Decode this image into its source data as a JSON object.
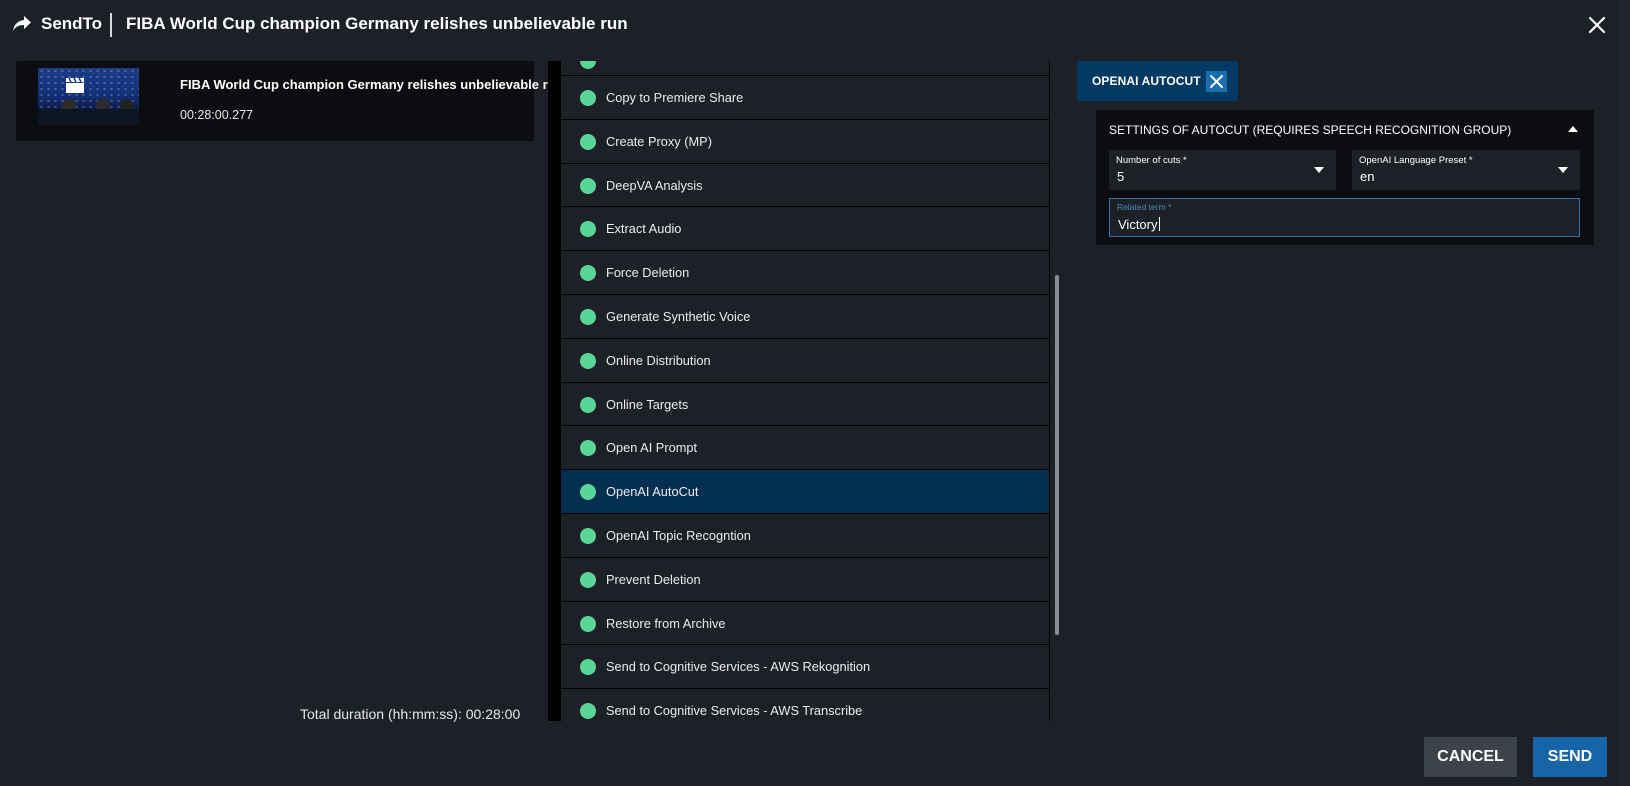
{
  "header": {
    "app_name": "SendTo",
    "title": "FIBA World Cup champion Germany relishes unbelievable run"
  },
  "asset": {
    "title": "FIBA World Cup champion Germany relishes unbelievable run",
    "duration": "00:28:00.277"
  },
  "summary": {
    "total_duration_label": "Total duration (hh:mm:ss):",
    "total_duration_value": "00:28:00"
  },
  "workflows": {
    "selected": "OpenAI AutoCut",
    "status_color": "#5ad598",
    "items": [
      {
        "label": "Copy to Premiere Share"
      },
      {
        "label": "Create Proxy (MP)"
      },
      {
        "label": "DeepVA Analysis"
      },
      {
        "label": "Extract Audio"
      },
      {
        "label": "Force Deletion"
      },
      {
        "label": "Generate Synthetic Voice"
      },
      {
        "label": "Online Distribution"
      },
      {
        "label": "Online Targets"
      },
      {
        "label": "Open AI Prompt"
      },
      {
        "label": "OpenAI AutoCut"
      },
      {
        "label": "OpenAI Topic Recogntion"
      },
      {
        "label": "Prevent Deletion"
      },
      {
        "label": "Restore from Archive"
      },
      {
        "label": "Send to Cognitive Services - AWS Rekognition"
      },
      {
        "label": "Send to Cognitive Services - AWS Transcribe"
      }
    ]
  },
  "config": {
    "tab_label": "OPENAI AUTOCUT",
    "section_title": "SETTINGS OF AUTOCUT (REQUIRES SPEECH RECOGNITION GROUP)",
    "num_cuts": {
      "label": "Number of cuts *",
      "value": "5"
    },
    "language_preset": {
      "label": "OpenAI Language Preset *",
      "value": "en"
    },
    "related_term": {
      "label": "Related term *",
      "value": "Victory"
    }
  },
  "footer": {
    "cancel_label": "CANCEL",
    "send_label": "SEND"
  },
  "colors": {
    "background": "#1d2127",
    "accent": "#1765a7",
    "selected_row": "#033050"
  }
}
